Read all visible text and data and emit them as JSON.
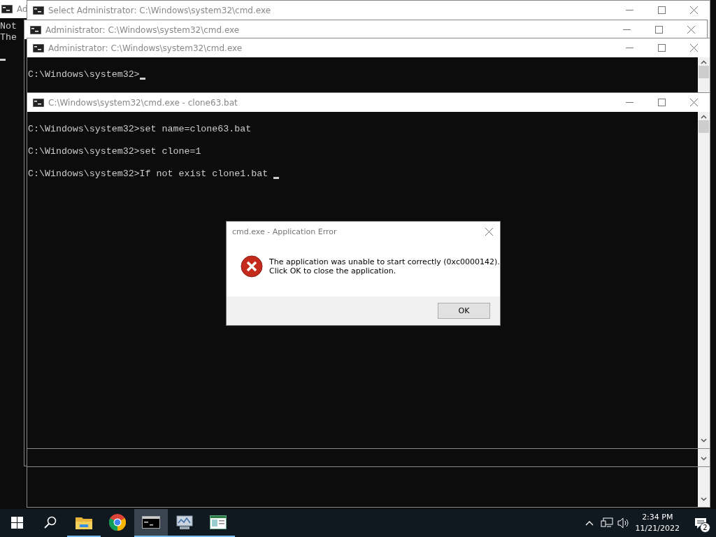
{
  "back_window": {
    "title": "Ad",
    "lines": [
      "Not",
      "The"
    ],
    "cursor": true
  },
  "windows": [
    {
      "title": "Select Administrator: C:\\Windows\\system32\\cmd.exe"
    },
    {
      "title": "Administrator: C:\\Windows\\system32\\cmd.exe"
    },
    {
      "title": "Administrator: C:\\Windows\\system32\\cmd.exe",
      "lines": [
        "C:\\Windows\\system32>"
      ],
      "cursor": true
    },
    {
      "title": "C:\\Windows\\system32\\cmd.exe - clone63.bat",
      "lines": [
        "C:\\Windows\\system32>set name=clone63.bat",
        "C:\\Windows\\system32>set clone=1",
        "C:\\Windows\\system32>If not exist clone1.bat "
      ],
      "cursor": true
    }
  ],
  "dialog": {
    "title": "cmd.exe - Application Error",
    "message": [
      "The application was unable to start correctly (0xc0000142).",
      "Click OK to close the application."
    ],
    "button": "OK"
  },
  "taskbar": {
    "apps": [
      {
        "kind": "folder",
        "selected": false,
        "running": true
      },
      {
        "kind": "chrome",
        "selected": false,
        "running": false
      },
      {
        "kind": "console",
        "selected": true,
        "running": true
      },
      {
        "kind": "monitor",
        "selected": false,
        "running": true
      },
      {
        "kind": "panel",
        "selected": false,
        "running": true
      }
    ],
    "time": "2:34 PM",
    "date": "11/21/2022",
    "notification_count": "2"
  }
}
